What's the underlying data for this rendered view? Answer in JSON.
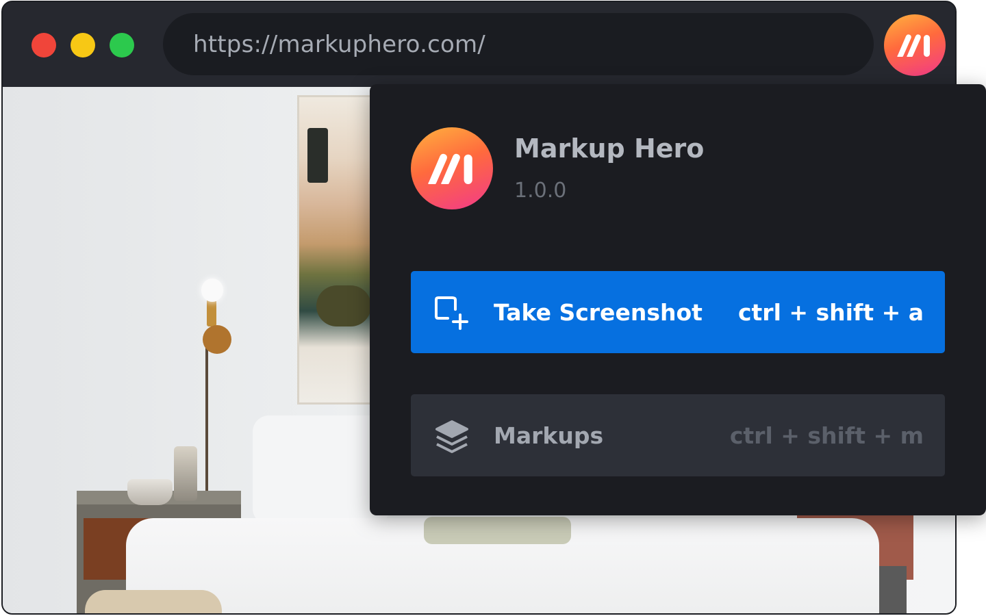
{
  "browser": {
    "url": "https://markuphero.com/",
    "traffic_lights": {
      "close_color": "#f0453a",
      "minimize_color": "#f7c815",
      "maximize_color": "#2cc94d"
    },
    "extension_icon": "markup-hero-logo-icon"
  },
  "popup": {
    "app_name": "Markup Hero",
    "version": "1.0.0",
    "actions": [
      {
        "label": "Take Screenshot",
        "shortcut": "ctrl + shift + a",
        "icon": "screenshot-add-icon",
        "color": "#0670e0"
      },
      {
        "label": "Markups",
        "shortcut": "ctrl + shift + m",
        "icon": "layers-icon",
        "color": "#2d3038"
      }
    ]
  },
  "colors": {
    "brand_gradient": [
      "#ffb23f",
      "#ff6a3d",
      "#f23a8a"
    ],
    "popup_background": "#1b1c21"
  }
}
